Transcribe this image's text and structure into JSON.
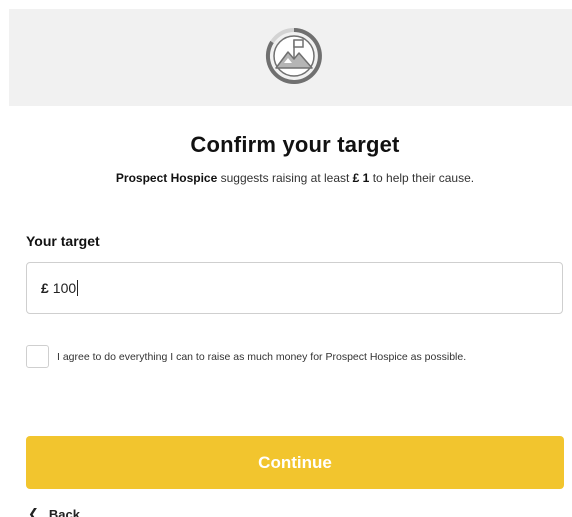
{
  "header": {
    "logo_icon": "mountain-flag-progress-icon"
  },
  "main": {
    "title": "Confirm your target",
    "subtitle_org": "Prospect Hospice",
    "subtitle_middle": " suggests raising at least ",
    "subtitle_amount": "£ 1",
    "subtitle_end": " to help their cause.",
    "target_label": "Your target",
    "target_currency": "£",
    "target_value": "100",
    "agree_text": "I agree to do everything I can to raise as much money for Prospect Hospice as possible.",
    "agree_checked": false,
    "continue_label": "Continue",
    "back_label": "Back"
  },
  "colors": {
    "accent": "#f2c52e",
    "band": "#f1f1f1",
    "logo_gray": "#6e6e6e"
  }
}
